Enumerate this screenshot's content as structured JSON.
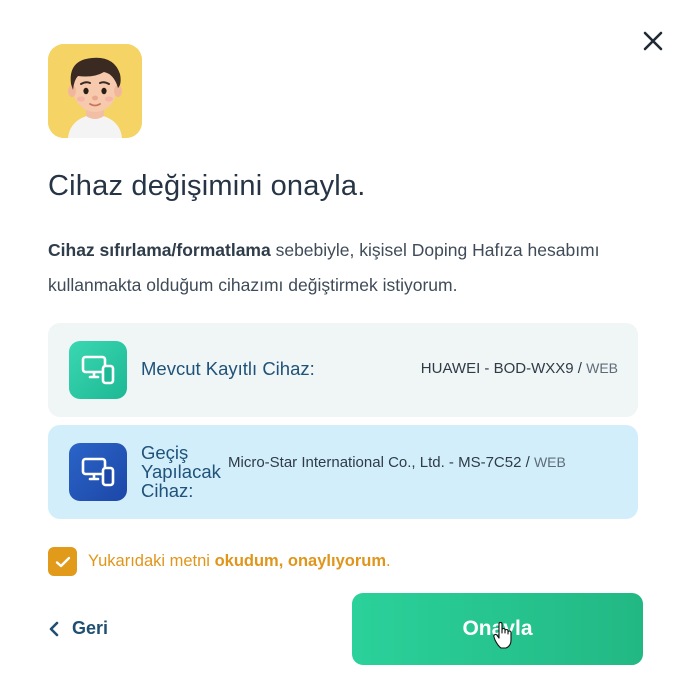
{
  "dialog": {
    "title": "Cihaz değişimini onayla.",
    "description_bold": "Cihaz sıfırlama/formatlama",
    "description_rest": " sebebiyle, kişisel Doping Hafıza hesabımı kullanmakta olduğum cihazımı değiştirmek istiyorum."
  },
  "current_device": {
    "label": "Mevcut Kayıtlı Cihaz:",
    "device": "HUAWEI - BOD-WXX9",
    "separator": " / ",
    "platform": "WEB"
  },
  "next_device": {
    "label": "Geçiş Yapılacak Cihaz:",
    "device": "Micro-Star International Co., Ltd. - MS-7C52",
    "separator": " / ",
    "platform": "WEB"
  },
  "consent": {
    "checked": true,
    "text_prefix": "Yukarıdaki metni ",
    "text_bold": "okudum, onaylıyorum",
    "text_suffix": "."
  },
  "actions": {
    "back_label": "Geri",
    "confirm_label": "Onayla"
  },
  "colors": {
    "accent_green": "#22b884",
    "accent_orange": "#e29a1a",
    "current_card_bg": "#f0f5f6",
    "next_card_bg": "#d3eefb",
    "title_color": "#263445"
  },
  "icons": {
    "close": "close-icon",
    "device": "device-icon",
    "check": "check-icon",
    "back": "chevron-left-icon"
  }
}
